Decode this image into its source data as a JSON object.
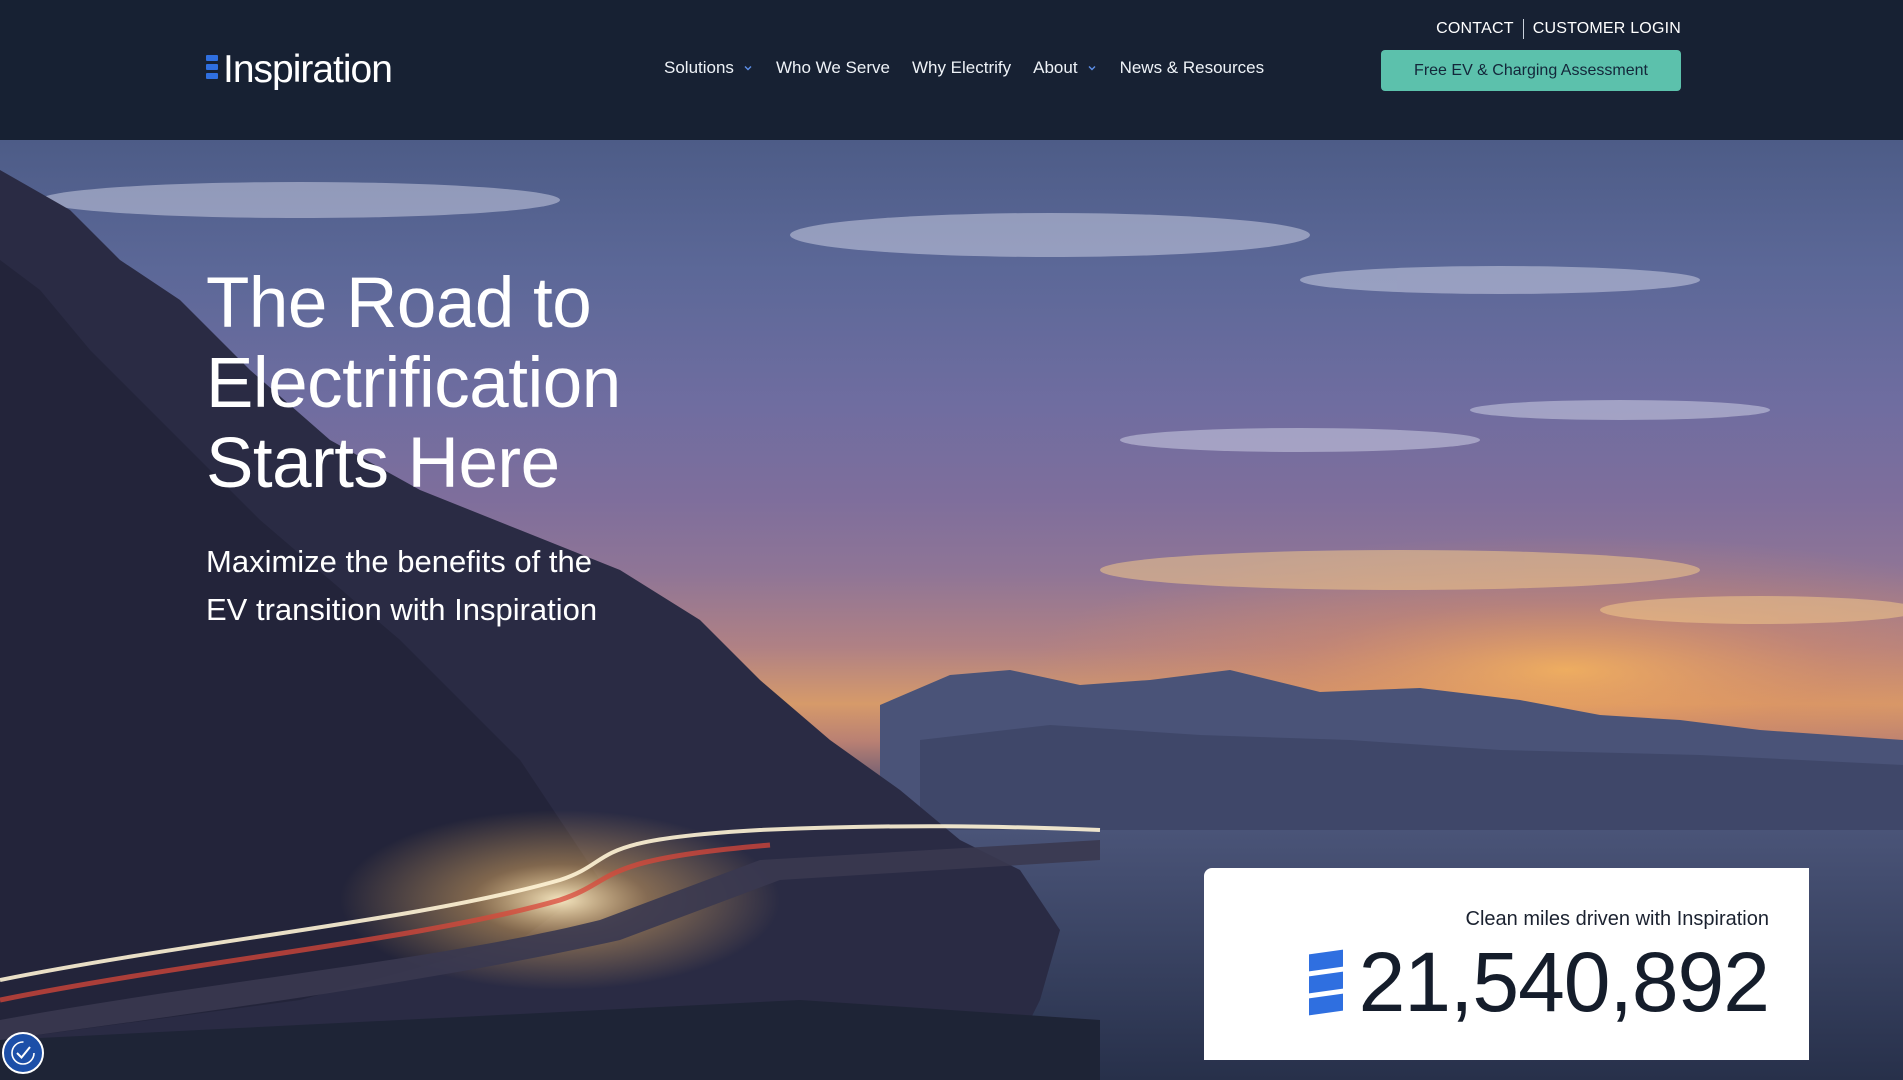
{
  "brand": {
    "name": "Inspiration",
    "accent": "#2f6fe0"
  },
  "utility_nav": {
    "contact": "CONTACT",
    "login": "CUSTOMER LOGIN"
  },
  "nav": {
    "items": [
      {
        "label": "Solutions",
        "has_dropdown": true
      },
      {
        "label": "Who We Serve",
        "has_dropdown": false
      },
      {
        "label": "Why Electrify",
        "has_dropdown": false
      },
      {
        "label": "About",
        "has_dropdown": true
      },
      {
        "label": "News & Resources",
        "has_dropdown": false
      }
    ]
  },
  "cta": {
    "label": "Free EV & Charging Assessment",
    "color": "#5cc1ac"
  },
  "hero": {
    "headline_lines": [
      "The Road to",
      "Electrification",
      "Starts Here"
    ],
    "subhead_lines": [
      "Maximize the benefits of the",
      "EV transition with Inspiration"
    ]
  },
  "stat": {
    "label": "Clean miles driven with Inspiration",
    "value": "21,540,892"
  },
  "icons": {
    "dropdown": "chevron-down-icon",
    "accessibility": "accessibility-icon",
    "logo": "logo-mark-icon"
  }
}
